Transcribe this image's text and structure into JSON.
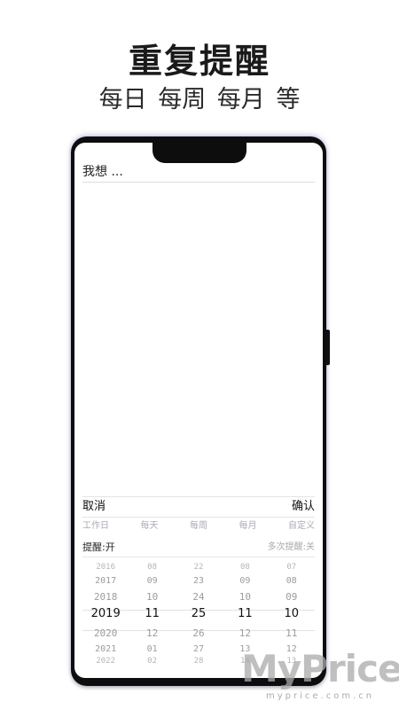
{
  "header": {
    "title": "重复提醒",
    "subtitle": "每日 每周 每月 等"
  },
  "app": {
    "input_placeholder": "我想 ...",
    "cancel_label": "取消",
    "confirm_label": "确认",
    "tabs": [
      "工作日",
      "每天",
      "每周",
      "每月",
      "自定义"
    ],
    "reminder_toggle": "提醒:开",
    "multi_reminder_toggle": "多次提醒:关",
    "picker": {
      "columns": [
        [
          "2016",
          "2017",
          "2018",
          "2019",
          "2020",
          "2021",
          "2022"
        ],
        [
          "08",
          "09",
          "10",
          "11",
          "12",
          "01",
          "02"
        ],
        [
          "22",
          "23",
          "24",
          "25",
          "26",
          "27",
          "28"
        ],
        [
          "08",
          "09",
          "10",
          "11",
          "12",
          "13",
          "14"
        ],
        [
          "07",
          "08",
          "09",
          "10",
          "11",
          "12",
          "13"
        ]
      ],
      "selected_index": 3
    }
  },
  "watermark": {
    "text": "MyPrice",
    "url": "myprice.com.cn"
  }
}
